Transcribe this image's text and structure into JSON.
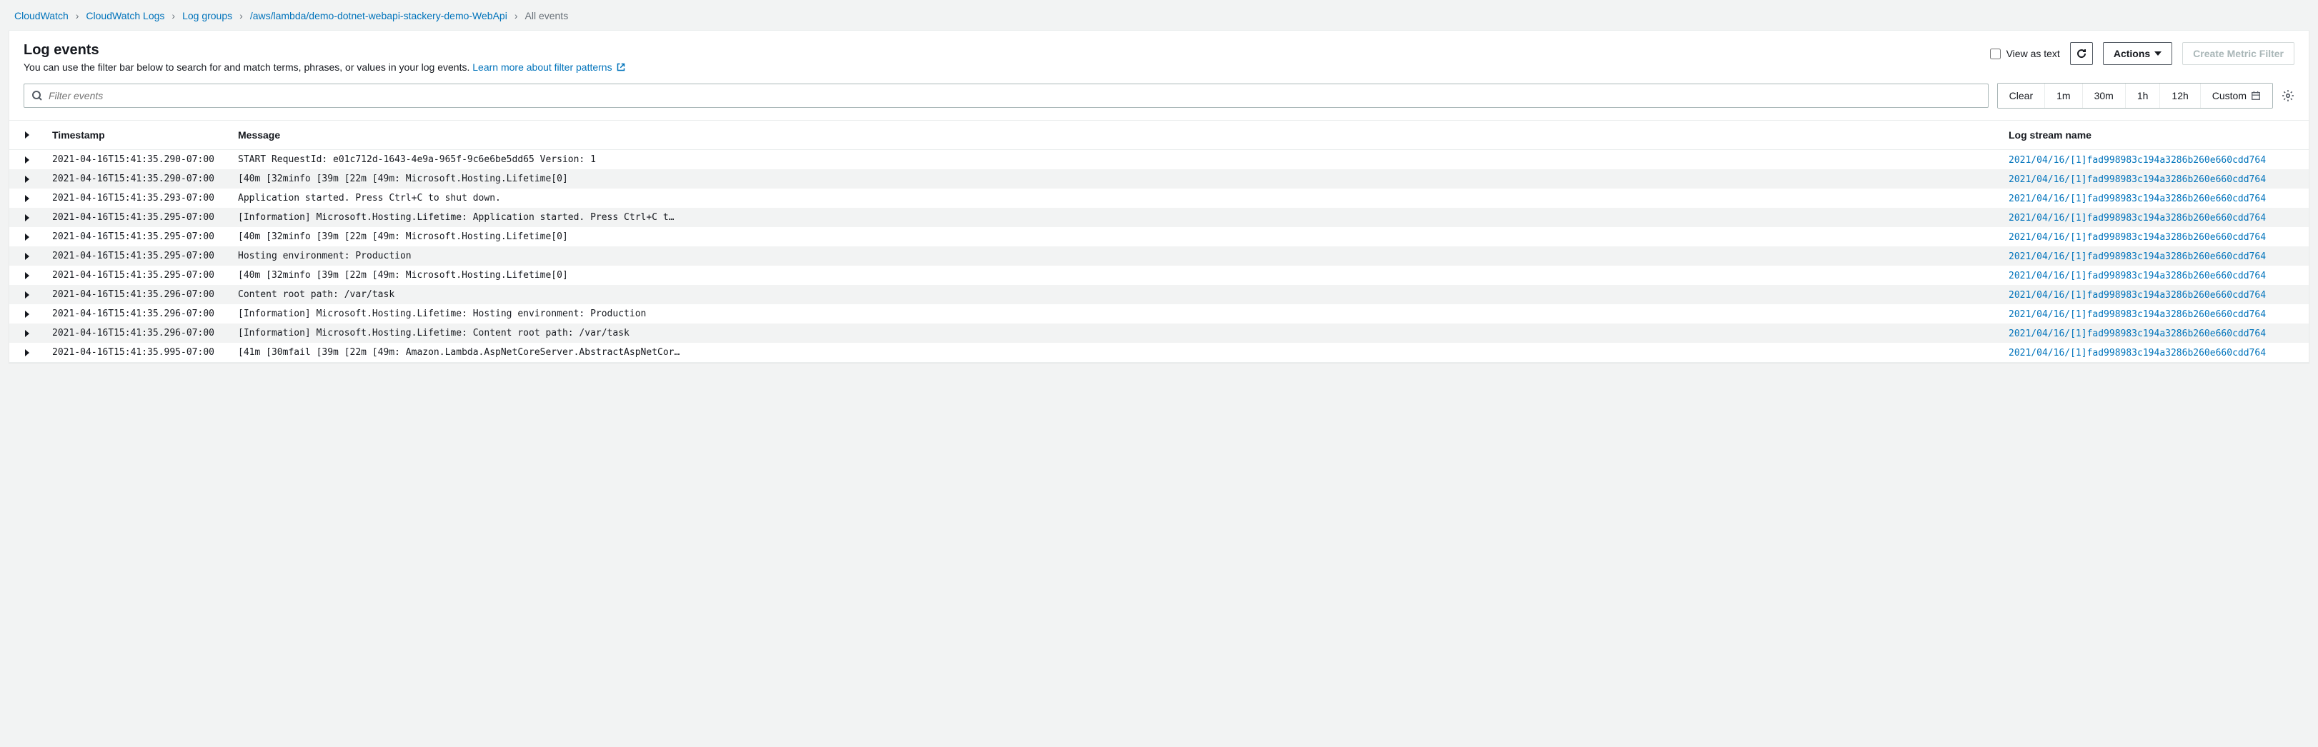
{
  "breadcrumbs": [
    {
      "label": "CloudWatch",
      "link": true
    },
    {
      "label": "CloudWatch Logs",
      "link": true
    },
    {
      "label": "Log groups",
      "link": true
    },
    {
      "label": "/aws/lambda/demo-dotnet-webapi-stackery-demo-WebApi",
      "link": true
    },
    {
      "label": "All events",
      "link": false
    }
  ],
  "header": {
    "title": "Log events",
    "subtitle": "You can use the filter bar below to search for and match terms, phrases, or values in your log events.",
    "learn_more": "Learn more about filter patterns",
    "view_as_text": "View as text",
    "actions": "Actions",
    "create_metric_filter": "Create Metric Filter"
  },
  "filter": {
    "placeholder": "Filter events",
    "time": [
      "Clear",
      "1m",
      "30m",
      "1h",
      "12h",
      "Custom"
    ]
  },
  "columns": {
    "expand": "",
    "timestamp": "Timestamp",
    "message": "Message",
    "stream": "Log stream name"
  },
  "rows": [
    {
      "ts": "2021-04-16T15:41:35.290-07:00",
      "msg": "START RequestId: e01c712d-1643-4e9a-965f-9c6e6be5dd65 Version: 1",
      "stream": "2021/04/16/[1]fad998983c194a3286b260e660cdd764"
    },
    {
      "ts": "2021-04-16T15:41:35.290-07:00",
      "msg": "[40m [32minfo [39m [22m [49m: Microsoft.Hosting.Lifetime[0]",
      "stream": "2021/04/16/[1]fad998983c194a3286b260e660cdd764"
    },
    {
      "ts": "2021-04-16T15:41:35.293-07:00",
      "msg": "Application started. Press Ctrl+C to shut down.",
      "stream": "2021/04/16/[1]fad998983c194a3286b260e660cdd764"
    },
    {
      "ts": "2021-04-16T15:41:35.295-07:00",
      "msg": "[Information] Microsoft.Hosting.Lifetime: Application started. Press Ctrl+C t…",
      "stream": "2021/04/16/[1]fad998983c194a3286b260e660cdd764"
    },
    {
      "ts": "2021-04-16T15:41:35.295-07:00",
      "msg": "[40m [32minfo [39m [22m [49m: Microsoft.Hosting.Lifetime[0]",
      "stream": "2021/04/16/[1]fad998983c194a3286b260e660cdd764"
    },
    {
      "ts": "2021-04-16T15:41:35.295-07:00",
      "msg": "Hosting environment: Production",
      "stream": "2021/04/16/[1]fad998983c194a3286b260e660cdd764"
    },
    {
      "ts": "2021-04-16T15:41:35.295-07:00",
      "msg": "[40m [32minfo [39m [22m [49m: Microsoft.Hosting.Lifetime[0]",
      "stream": "2021/04/16/[1]fad998983c194a3286b260e660cdd764"
    },
    {
      "ts": "2021-04-16T15:41:35.296-07:00",
      "msg": "Content root path: /var/task",
      "stream": "2021/04/16/[1]fad998983c194a3286b260e660cdd764"
    },
    {
      "ts": "2021-04-16T15:41:35.296-07:00",
      "msg": "[Information] Microsoft.Hosting.Lifetime: Hosting environment: Production",
      "stream": "2021/04/16/[1]fad998983c194a3286b260e660cdd764"
    },
    {
      "ts": "2021-04-16T15:41:35.296-07:00",
      "msg": "[Information] Microsoft.Hosting.Lifetime: Content root path: /var/task",
      "stream": "2021/04/16/[1]fad998983c194a3286b260e660cdd764"
    },
    {
      "ts": "2021-04-16T15:41:35.995-07:00",
      "msg": "[41m [30mfail [39m [22m [49m: Amazon.Lambda.AspNetCoreServer.AbstractAspNetCor…",
      "stream": "2021/04/16/[1]fad998983c194a3286b260e660cdd764"
    }
  ]
}
